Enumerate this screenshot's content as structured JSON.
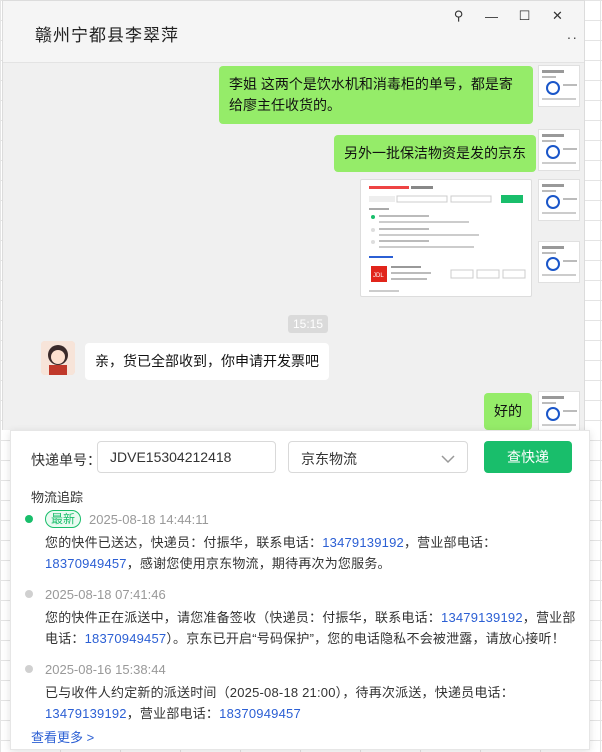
{
  "window": {
    "title": "赣州宁都县李翠萍",
    "controls": {
      "pin": "⚲",
      "minimize": "—",
      "maximize": "☐",
      "close": "✕"
    },
    "more": "⋰"
  },
  "chat": {
    "messages": [
      {
        "text": "李姐 这两个是饮水机和消毒柜的单号，都是寄给廖主任收货的。"
      },
      {
        "text": "另外一批保洁物资是发的京东"
      },
      {
        "text": "好的"
      }
    ],
    "time_divider": "15:15",
    "incoming": {
      "text": "亲，货已全部收到，你申请开发票吧"
    }
  },
  "tracking": {
    "label": "快递单号：",
    "number": "JDVE15304212418",
    "carrier": "京东物流",
    "query_button": "查快递",
    "section_title": "物流追踪",
    "latest_tag": "最新",
    "events": [
      {
        "time": "2025-08-18 14:44:11",
        "parts": [
          "您的快件已送达，快递员：付振华，联系电话：",
          "13479139192",
          "，营业部电话：",
          "18370949457",
          "，感谢您使用京东物流，期待再次为您服务。"
        ]
      },
      {
        "time": "2025-08-18 07:41:46",
        "parts": [
          "您的快件正在派送中，请您准备签收（快递员：付振华，联系电话：",
          "13479139192",
          "，营业部电话：",
          "18370949457",
          "）。京东已开启“号码保护”，您的电话隐私不会被泄露，请放心接听！"
        ]
      },
      {
        "time": "2025-08-16 15:38:44",
        "parts": [
          "已与收件人约定新的派送时间（2025-08-18 21:00），待再次派送，快递员电话：",
          "13479139192",
          "，营业部电话：",
          "18370949457",
          ""
        ]
      }
    ],
    "more_link": "查看更多 >"
  },
  "colors": {
    "accent": "#19be6b",
    "bubble": "#95ec69",
    "link": "#2b5fd4"
  }
}
